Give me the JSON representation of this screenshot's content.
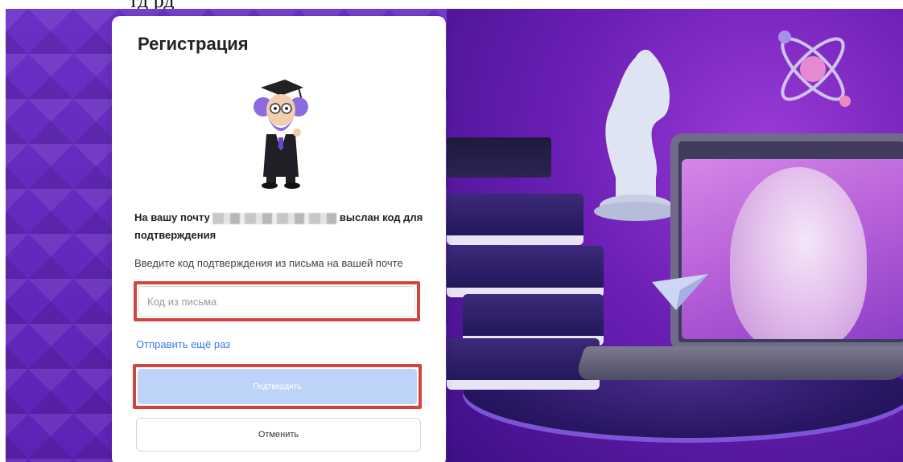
{
  "top_fragment": "тд      рд",
  "registration": {
    "title": "Регистрация",
    "info_prefix": "На вашу почту",
    "info_suffix": "выслан код для подтверждения",
    "instruction": "Введите код подтверждения из письма на вашей почте",
    "code_input": {
      "placeholder": "Код из письма",
      "value": ""
    },
    "resend_label": "Отправить ещё раз",
    "confirm_label": "Подтвердить",
    "cancel_label": "Отменить"
  },
  "colors": {
    "accent_purple": "#6a2fc4",
    "highlight_red": "#d0453c",
    "link_blue": "#3d7be6",
    "confirm_disabled": "#bdd4f8"
  }
}
